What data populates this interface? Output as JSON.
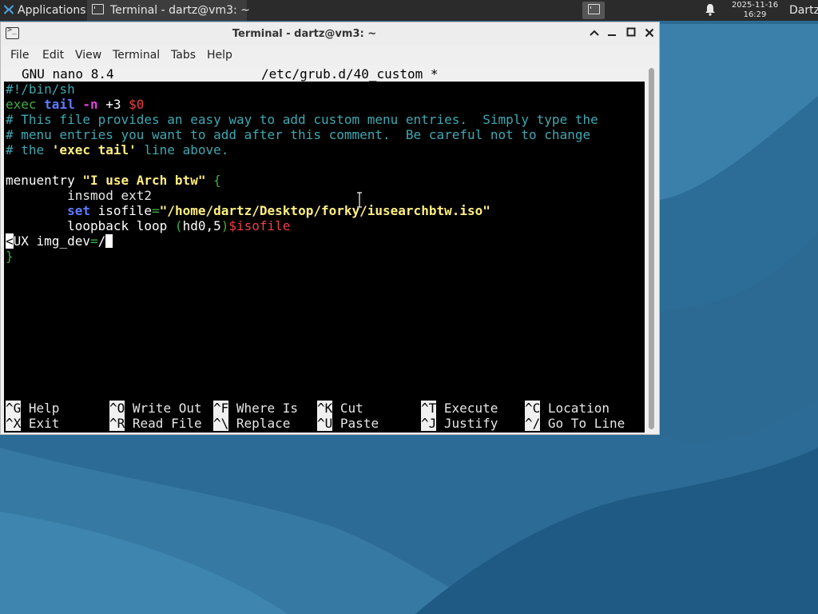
{
  "panel": {
    "applications_label": "Applications",
    "applications_suffix": "☰",
    "taskbar_label": "Terminal - dartz@vm3: ~",
    "clock_date": "2025-11-16",
    "clock_time": "16:29",
    "user": "Dartz"
  },
  "window": {
    "title": "Terminal - dartz@vm3: ~",
    "menu": [
      "File",
      "Edit",
      "View",
      "Terminal",
      "Tabs",
      "Help"
    ]
  },
  "nano": {
    "version": "GNU nano 8.4",
    "filename": "/etc/grub.d/40_custom *",
    "lines": {
      "l1": "#!/bin/sh",
      "l2": {
        "a": "exec",
        "b": "tail",
        "c": "-n",
        "d": "+3",
        "e": "$0"
      },
      "l3": "# This file provides an easy way to add custom menu entries.  Simply type the",
      "l4": "# menu entries you want to add after this comment.  Be careful not to change",
      "l5": {
        "a": "# the ",
        "b": "'exec tail'",
        "c": " line above."
      },
      "l7": {
        "a": "menuentry ",
        "b": "\"I use Arch btw\"",
        "c": " {"
      },
      "l8": "        insmod ext2",
      "l9": {
        "indent": "        ",
        "a": "set",
        "b": " isofile",
        "c": "=",
        "d": "\"/home/dartz/Desktop/forky/iusearchbtw.iso\""
      },
      "l10": {
        "indent": "        ",
        "a": "loopback loop ",
        "b": "(",
        "c": "hd0,5",
        "d": ")",
        "e": "$isofile"
      },
      "l11": {
        "a": "<",
        "b": "UX img_dev",
        "c": "=",
        "d": "/"
      },
      "l12": "}"
    },
    "shortcuts_row1": [
      {
        "key": "^G",
        "label": "Help"
      },
      {
        "key": "^O",
        "label": "Write Out"
      },
      {
        "key": "^F",
        "label": "Where Is"
      },
      {
        "key": "^K",
        "label": "Cut"
      },
      {
        "key": "^T",
        "label": "Execute"
      },
      {
        "key": "^C",
        "label": "Location"
      }
    ],
    "shortcuts_row2": [
      {
        "key": "^X",
        "label": "Exit"
      },
      {
        "key": "^R",
        "label": "Read File"
      },
      {
        "key": "^\\",
        "label": "Replace"
      },
      {
        "key": "^U",
        "label": "Paste"
      },
      {
        "key": "^J",
        "label": "Justify"
      },
      {
        "key": "^/",
        "label": "Go To Line"
      }
    ]
  },
  "colors": {
    "panel_bg": "#2b2b2b",
    "comment": "#3fa8b2",
    "keyword_green": "#3cb043",
    "keyword_blue": "#5f7bff",
    "string_yellow": "#ffef80",
    "variable_red": "#f04040",
    "flag_magenta": "#e040e0"
  },
  "icons": {
    "apps": "xfce-mouse-icon",
    "taskbar": "terminal-icon",
    "notification": "bell-icon",
    "window": "terminal-icon",
    "close": "close-icon",
    "maximize": "maximize-icon",
    "minimize": "minimize-icon"
  }
}
